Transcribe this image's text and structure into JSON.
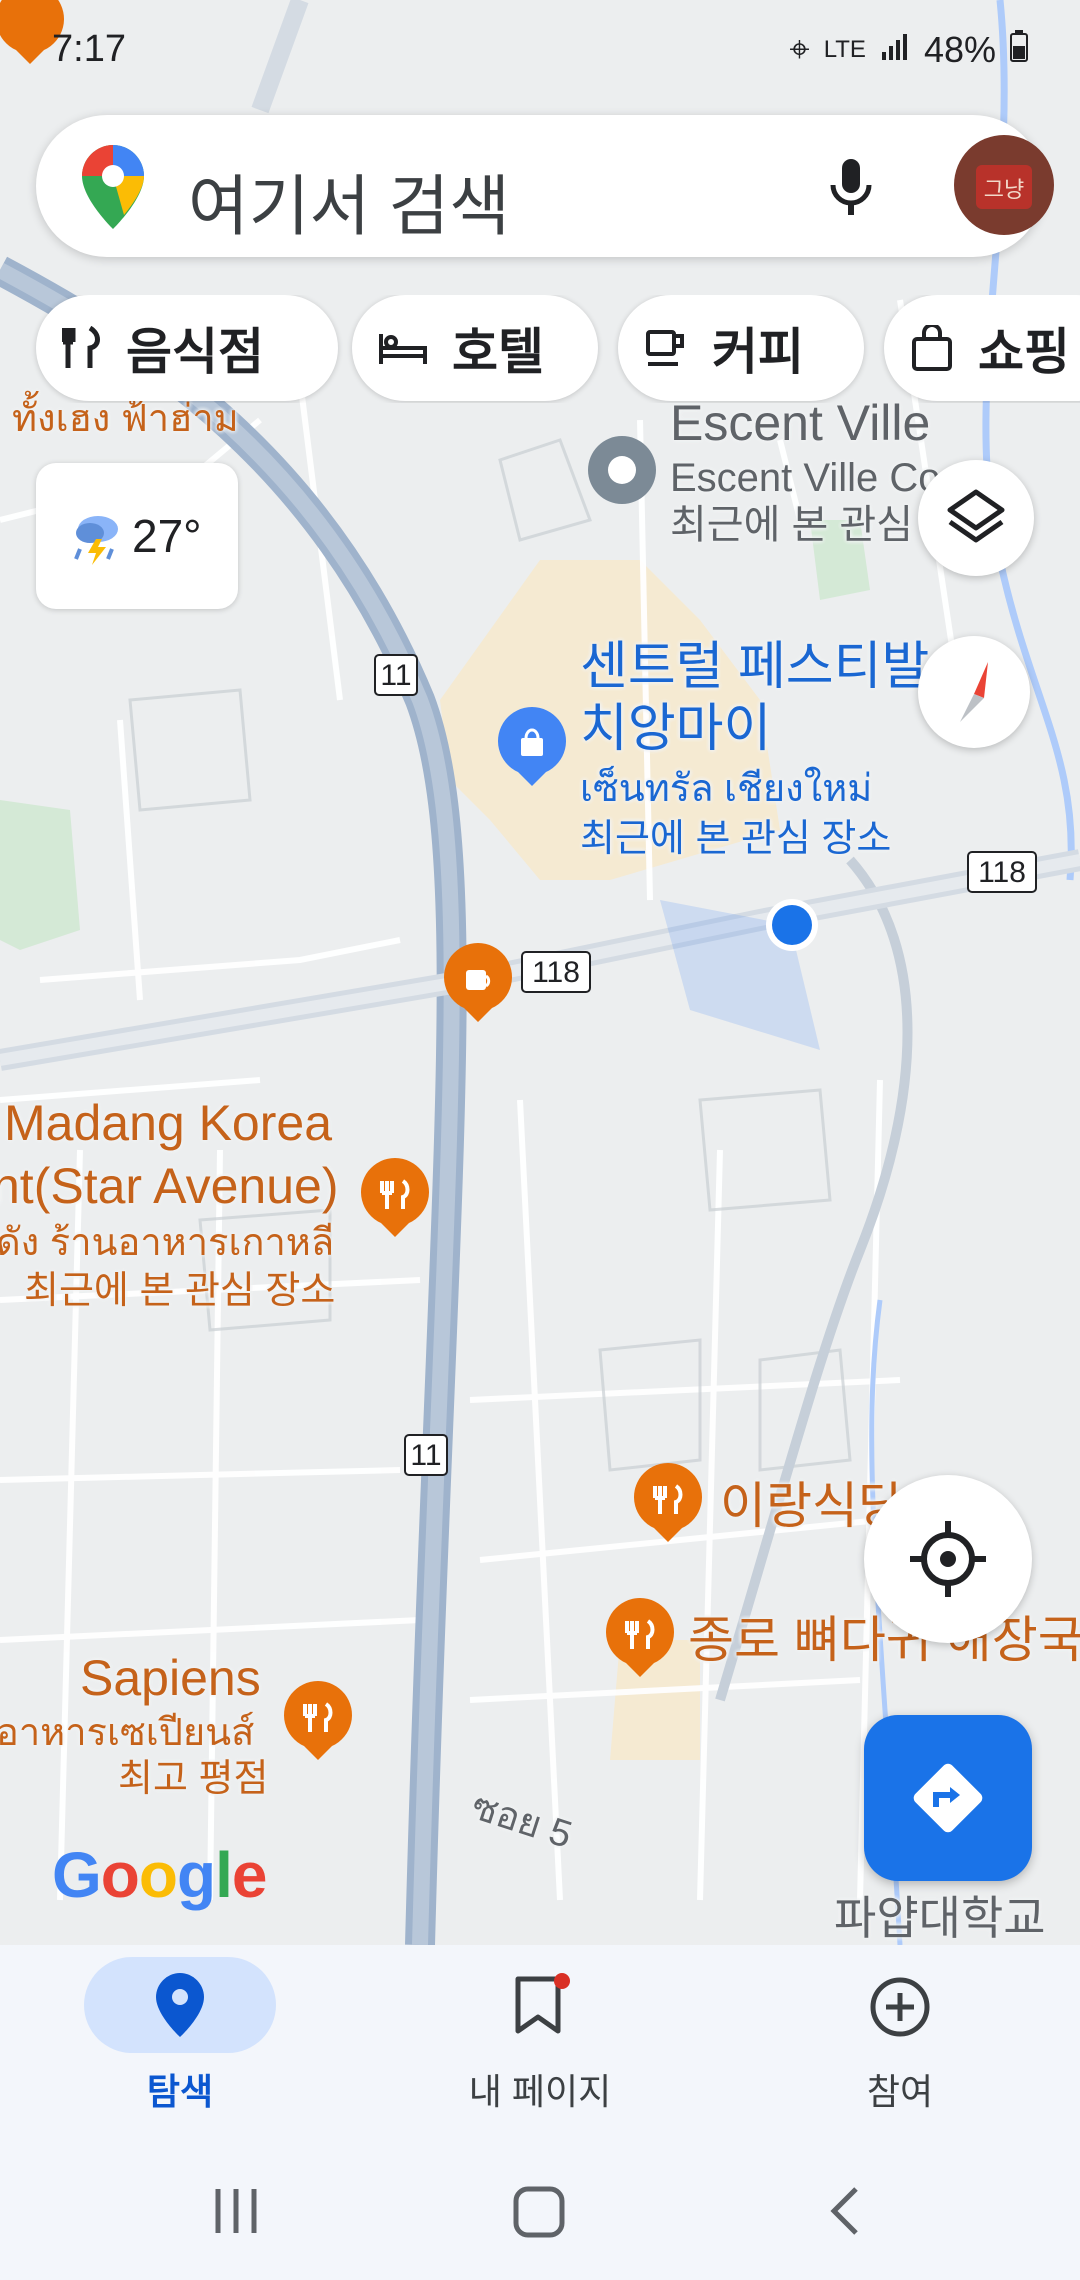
{
  "status_bar": {
    "time": "7:17",
    "battery": "48%",
    "network": "LTE"
  },
  "search": {
    "placeholder": "여기서 검색",
    "mic_icon": "mic-icon",
    "avatar_text": "그냥"
  },
  "chips": [
    {
      "label": "음식점",
      "icon": "restaurant-icon"
    },
    {
      "label": "호텔",
      "icon": "hotel-icon"
    },
    {
      "label": "커피",
      "icon": "coffee-icon"
    },
    {
      "label": "쇼핑",
      "icon": "shopping-icon"
    }
  ],
  "weather": {
    "temp": "27°",
    "icon": "thunderstorm-icon"
  },
  "map": {
    "places": {
      "escent_title": "Escent Ville",
      "escent_sub": "Escent Ville Co",
      "escent_note": "최근에 본 관심",
      "central_title1": "센트럴 페스티발",
      "central_title2": "치앙마이",
      "central_thai": "เซ็นทรัล เชียงใหม่",
      "central_note": "최근에 본 관심 장소",
      "madang_title1": "Madang Korea",
      "madang_title2": "nt(Star Avenue)",
      "madang_thai": "ดัง ร้านอาหารเกาหลี",
      "madang_note": "최근에 본 관심 장소",
      "irang": "이랑식당",
      "jongro": "종로 뼈다귀 해장국",
      "sapiens_title": "Sapiens",
      "sapiens_thai": "อาหารเซเปียนส์",
      "sapiens_note": "최고 평점",
      "thai_top_left": "ทั้งเฮง ฟ้าฮ่าม",
      "soi5": "ซอย 5",
      "payap": "파얍대학교"
    },
    "road_shields": [
      "11",
      "11",
      "118",
      "118"
    ],
    "google_logo": "Google",
    "colors": {
      "restaurant": "#e8710a",
      "shopping": "#1a73e8",
      "location_dot": "#1a73e8",
      "highway": "#9fb3cc"
    }
  },
  "controls": {
    "layers_icon": "layers-icon",
    "compass_icon": "compass-icon",
    "my_location_icon": "my-location-icon",
    "directions_icon": "directions-icon"
  },
  "bottom_nav": [
    {
      "label": "탐색",
      "icon": "location-pin-icon",
      "active": true
    },
    {
      "label": "내 페이지",
      "icon": "bookmark-icon",
      "active": false
    },
    {
      "label": "참여",
      "icon": "add-circle-icon",
      "active": false
    }
  ],
  "system_nav": [
    "recents-icon",
    "home-icon",
    "back-icon"
  ]
}
